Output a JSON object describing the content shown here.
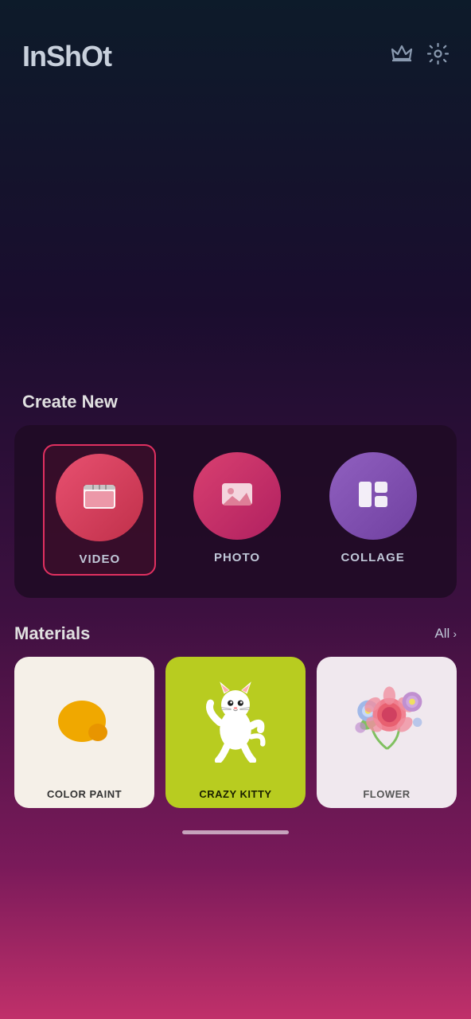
{
  "app": {
    "name": "InShot",
    "header": {
      "logo": "InShOt",
      "crown_icon": "👑",
      "settings_icon": "⚙"
    }
  },
  "create_new": {
    "section_title": "Create New",
    "items": [
      {
        "id": "video",
        "label": "VIDEO",
        "selected": true
      },
      {
        "id": "photo",
        "label": "PHOTO",
        "selected": false
      },
      {
        "id": "collage",
        "label": "COLLAGE",
        "selected": false
      }
    ]
  },
  "materials": {
    "section_title": "Materials",
    "all_label": "All",
    "items": [
      {
        "id": "color-paint",
        "label": "COLOR PAINT"
      },
      {
        "id": "crazy-kitty",
        "label": "CRAZY KITTY"
      },
      {
        "id": "flower",
        "label": "FLOWER"
      }
    ]
  }
}
